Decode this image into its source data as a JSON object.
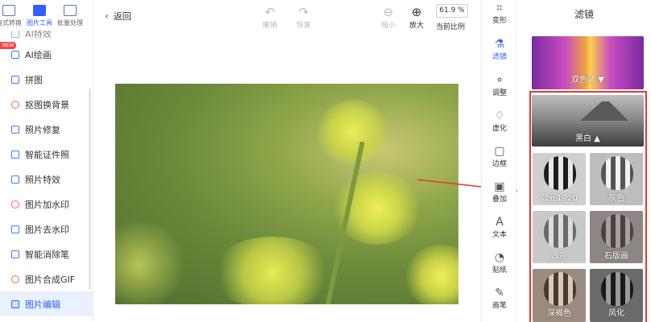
{
  "topnav": {
    "tabs": [
      {
        "label": "格式转换",
        "active": false
      },
      {
        "label": "图片工具",
        "active": true
      },
      {
        "label": "批量处理",
        "active": false
      }
    ]
  },
  "sidebar": {
    "new_badge": "NEW",
    "items": [
      {
        "label": "AI特效",
        "active": false
      },
      {
        "label": "AI绘画",
        "active": false
      },
      {
        "label": "拼图",
        "active": false
      },
      {
        "label": "抠图换背景",
        "active": false
      },
      {
        "label": "照片修复",
        "active": false
      },
      {
        "label": "智能证件照",
        "active": false
      },
      {
        "label": "照片特效",
        "active": false
      },
      {
        "label": "图片加水印",
        "active": false
      },
      {
        "label": "图片去水印",
        "active": false
      },
      {
        "label": "智能消除笔",
        "active": false
      },
      {
        "label": "图片合成GIF",
        "active": false
      },
      {
        "label": "图片编辑",
        "active": true
      }
    ]
  },
  "toolbar": {
    "back_label": "返回",
    "undo_label": "撤销",
    "redo_label": "恢复",
    "zoom_out_label": "缩小",
    "zoom_in_label": "放大",
    "zoom_value": "61.9 %",
    "zoom_caption": "当前比例"
  },
  "rail": {
    "items": [
      {
        "label": "变形",
        "icon": "crop-icon",
        "active": false
      },
      {
        "label": "滤镜",
        "icon": "flask-icon",
        "active": true
      },
      {
        "label": "调整",
        "icon": "adjust-icon",
        "active": false
      },
      {
        "label": "虚化",
        "icon": "drop-icon",
        "active": false
      },
      {
        "label": "边框",
        "icon": "frame-icon",
        "active": false
      },
      {
        "label": "叠加",
        "icon": "overlay-icon",
        "active": false
      },
      {
        "label": "文本",
        "icon": "text-icon",
        "active": false
      },
      {
        "label": "贴纸",
        "icon": "sticker-icon",
        "active": false
      },
      {
        "label": "画笔",
        "icon": "brush-icon",
        "active": false
      }
    ]
  },
  "panel": {
    "title": "滤镜",
    "categories": [
      {
        "label": "双色调 ▼"
      },
      {
        "label": "黑白 ▲"
      }
    ],
    "filters": [
      {
        "label": "公元1920"
      },
      {
        "label": "灰色"
      },
      {
        "label": "浅灰"
      },
      {
        "label": "石版画"
      },
      {
        "label": "深褐色"
      },
      {
        "label": "风化"
      }
    ]
  },
  "colors": {
    "accent": "#2f5fff",
    "highlight": "#e33b2e"
  }
}
